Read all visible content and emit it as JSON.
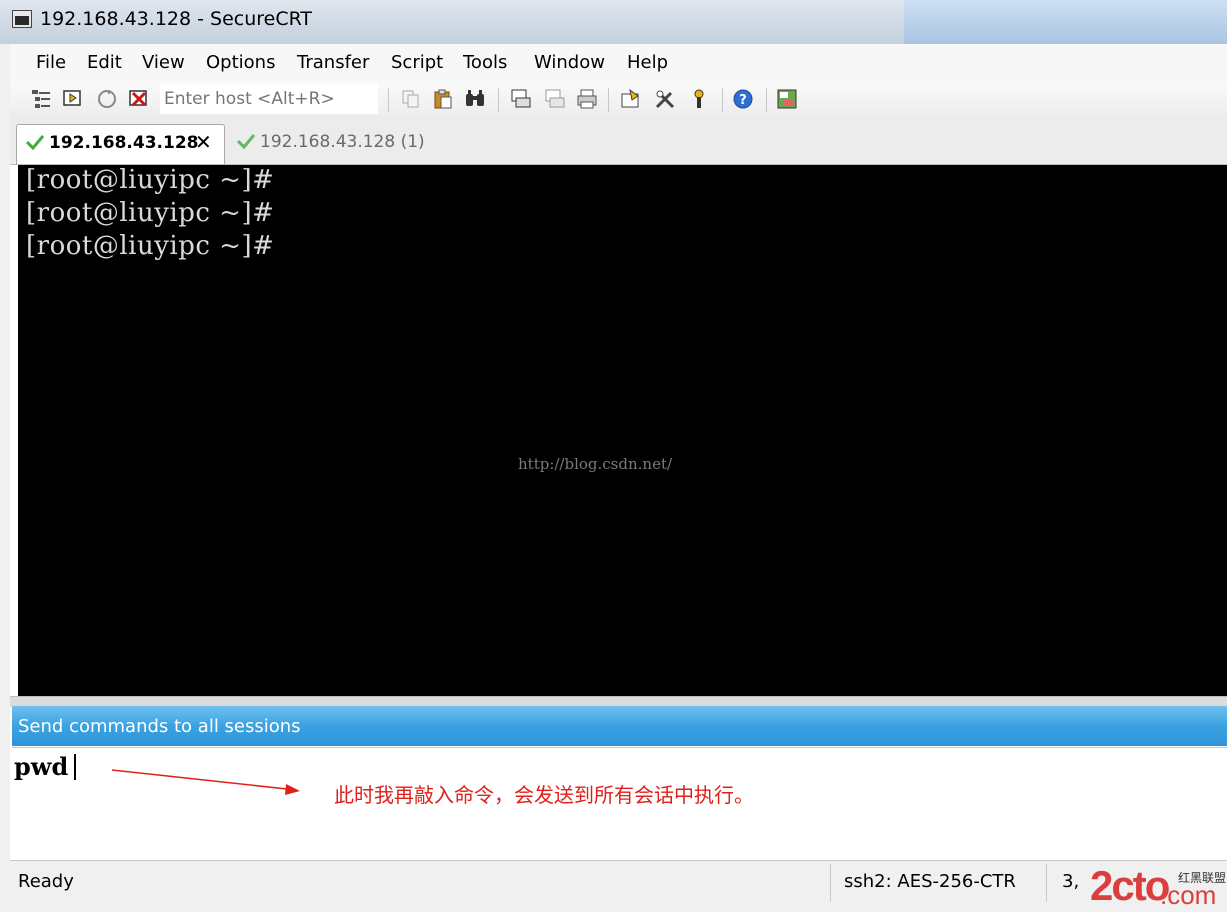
{
  "window": {
    "title": "192.168.43.128 - SecureCRT"
  },
  "menu": [
    "File",
    "Edit",
    "View",
    "Options",
    "Transfer",
    "Script",
    "Tools",
    "Window",
    "Help"
  ],
  "toolbar": {
    "host_placeholder": "Enter host <Alt+R>"
  },
  "tabs": [
    {
      "label": "192.168.43.128",
      "active": true
    },
    {
      "label": "192.168.43.128 (1)",
      "active": false
    }
  ],
  "terminal": {
    "lines": [
      "[root@liuyipc ~]#",
      "[root@liuyipc ~]#",
      "[root@liuyipc ~]#"
    ],
    "watermark": "http://blog.csdn.net/",
    "background": "#000000",
    "foreground": "#d9d9d9"
  },
  "send_pane": {
    "header": "Send commands to all sessions",
    "command": "pwd",
    "annotation": "此时我再敲入命令，会发送到所有会话中执行。",
    "annotation_color": "#e0201a"
  },
  "status": {
    "ready": "Ready",
    "cipher": "ssh2: AES-256-CTR",
    "position": "3,"
  },
  "logo": {
    "mark": "2cto",
    "suffix": ".com",
    "cn": "红黑联盟"
  }
}
